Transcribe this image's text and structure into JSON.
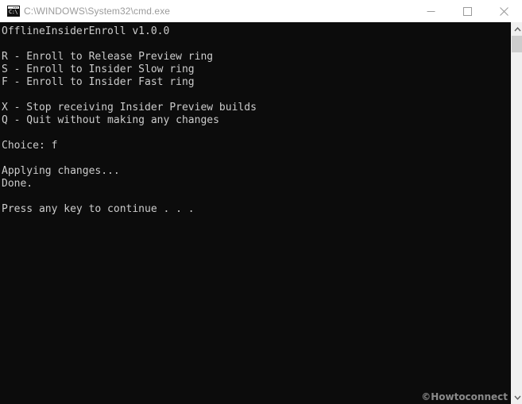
{
  "window": {
    "title": "C:\\WINDOWS\\System32\\cmd.exe",
    "icon_name": "cmd-console-icon",
    "icon_text": "C:\\",
    "titlebar_bg": "#ffffff",
    "title_color": "#9b9b9b",
    "console_bg": "#0c0c0c",
    "console_fg": "#cccccc",
    "controls": {
      "minimize_label": "Minimize",
      "maximize_label": "Maximize",
      "close_label": "Close"
    }
  },
  "console": {
    "text": "OfflineInsiderEnroll v1.0.0\n\nR - Enroll to Release Preview ring\nS - Enroll to Insider Slow ring\nF - Enroll to Insider Fast ring\n\nX - Stop receiving Insider Preview builds\nQ - Quit without making any changes\n\nChoice: f\n\nApplying changes...\nDone.\n\nPress any key to continue . . .",
    "lines": [
      "OfflineInsiderEnroll v1.0.0",
      "",
      "R - Enroll to Release Preview ring",
      "S - Enroll to Insider Slow ring",
      "F - Enroll to Insider Fast ring",
      "",
      "X - Stop receiving Insider Preview builds",
      "Q - Quit without making any changes",
      "",
      "Choice: f",
      "",
      "Applying changes...",
      "Done.",
      "",
      "Press any key to continue . . ."
    ],
    "app_name": "OfflineInsiderEnroll",
    "app_version": "v1.0.0",
    "menu_options": [
      {
        "key": "R",
        "label": "Enroll to Release Preview ring"
      },
      {
        "key": "S",
        "label": "Enroll to Insider Slow ring"
      },
      {
        "key": "F",
        "label": "Enroll to Insider Fast ring"
      },
      {
        "key": "X",
        "label": "Stop receiving Insider Preview builds"
      },
      {
        "key": "Q",
        "label": "Quit without making any changes"
      }
    ],
    "prompt_label": "Choice:",
    "prompt_value": "f",
    "status_applying": "Applying changes...",
    "status_done": "Done.",
    "continue_prompt": "Press any key to continue . . ."
  },
  "watermark": {
    "text": "©Howtoconnect",
    "color": "#8a8a8a"
  },
  "scrollbar": {
    "up_arrow_name": "scroll-up-arrow",
    "down_arrow_name": "scroll-down-arrow",
    "track_color": "#f0f0f0",
    "thumb_color": "#cdcdcd"
  }
}
